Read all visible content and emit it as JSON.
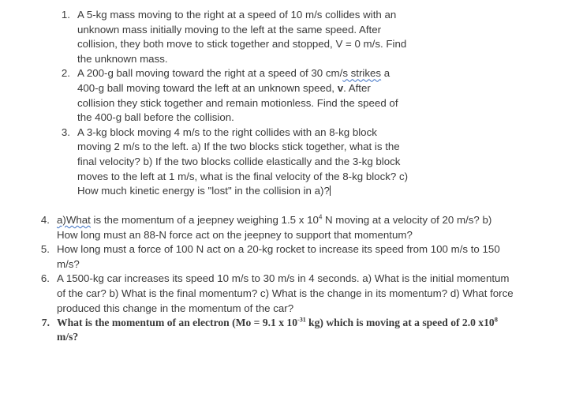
{
  "document": {
    "background_color": "#ffffff",
    "text_color": "#3a3a3a",
    "spellcheck_underline_color": "#3a6fc4"
  },
  "questions_group_a": [
    {
      "number": "1.",
      "segments": [
        {
          "text": "A 5-kg mass moving to the right at a speed of 10 m/s collides with an unknown mass initially moving to the left at the same speed.  After collision, they both move to stick together and stopped, V = 0 m/s. Find the unknown mass."
        }
      ]
    },
    {
      "number": "2.",
      "segments": [
        {
          "text": "A 200-g ball moving toward the right at a speed of 30 cm/"
        },
        {
          "text": "s strikes",
          "style": "spell"
        },
        {
          "text": " a 400-g ball moving toward the left at an unknown speed, "
        },
        {
          "text": "v",
          "style": "bold"
        },
        {
          "text": ". After collision they stick together and remain motionless. Find the speed of the 400-g ball before the collision."
        }
      ]
    },
    {
      "number": "3.",
      "segments": [
        {
          "text": "A 3-kg block moving 4 m/s to the right collides with an 8-kg block moving 2 m/s to the left. a) If the two blocks stick together, what is the final velocity? b) If the two blocks collide elastically and the 3-kg block moves to the left at 1 m/s, what is the final velocity of the 8-kg block? c) How much kinetic energy is \"lost\" in the collision in a)?"
        },
        {
          "text": "",
          "style": "caret"
        }
      ]
    }
  ],
  "questions_group_b": [
    {
      "number": "4.",
      "segments": [
        {
          "text": "a)What",
          "style": "spell"
        },
        {
          "text": " is the momentum of a jeepney weighing 1.5 x 10"
        },
        {
          "text": "4",
          "style": "sup"
        },
        {
          "text": " N moving at a velocity of 20 m/s?  b) How long must an 88-N force act on the jeepney to support that momentum?"
        }
      ]
    },
    {
      "number": "5.",
      "segments": [
        {
          "text": "How long must a force of 100 N act on a 20-kg rocket to increase its speed from 100 m/s to 150 m/s?"
        }
      ]
    },
    {
      "number": "6.",
      "segments": [
        {
          "text": "A 1500-kg car increases its speed 10 m/s to 30 m/s in 4 seconds. a) What is the initial momentum of the car? b) What is the final momentum? c) What is the change in its momentum? d) What force produced this change in the momentum of the car?"
        }
      ]
    },
    {
      "number": "7.",
      "font": "serif-bold",
      "segments": [
        {
          "text": "What is the momentum of an electron (Mo = 9.1 x 10"
        },
        {
          "text": "-31",
          "style": "sup"
        },
        {
          "text": " kg) which is moving at a speed of 2.0 x10"
        },
        {
          "text": "8",
          "style": "sup"
        },
        {
          "text": " m/s?"
        }
      ]
    }
  ]
}
